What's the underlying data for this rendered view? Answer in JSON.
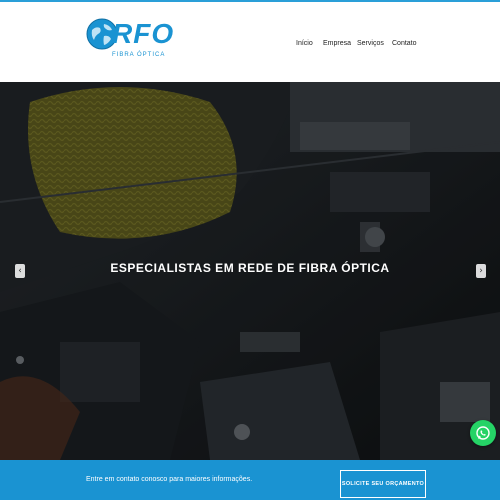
{
  "brand": {
    "name": "RFO",
    "tagline": "FIBRA ÓPTICA",
    "color": "#1a93d2"
  },
  "nav": {
    "items": [
      {
        "label": "Início"
      },
      {
        "label": "Empresa"
      },
      {
        "label": "Serviços"
      },
      {
        "label": "Contato"
      }
    ]
  },
  "hero": {
    "title": "ESPECIALISTAS EM REDE DE FIBRA ÓPTICA",
    "prev_icon": "chevron-left-icon",
    "next_icon": "chevron-right-icon"
  },
  "cta": {
    "text": "Entre em contato conosco para maiores informações.",
    "button_label": "SOLICITE SEU ORÇAMENTO",
    "background": "#1a93d2"
  },
  "whatsapp": {
    "icon": "whatsapp-icon",
    "color": "#25d366"
  }
}
